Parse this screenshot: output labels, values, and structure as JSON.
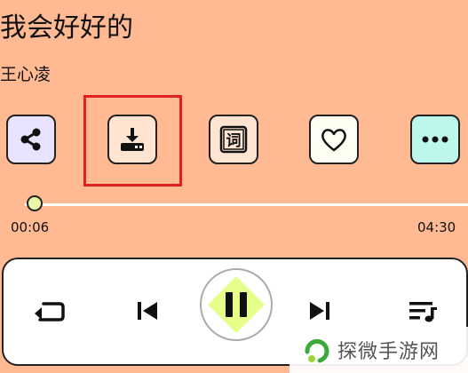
{
  "song": {
    "title": "我会好好的",
    "artist": "王心凌"
  },
  "actions": [
    {
      "name": "share",
      "icon": "share-icon",
      "bg": "#E9E3FF"
    },
    {
      "name": "download",
      "icon": "download-icon",
      "bg": "#FFE4D2"
    },
    {
      "name": "lyrics",
      "icon": "lyrics-icon",
      "label": "词",
      "bg": "#FFE4D2"
    },
    {
      "name": "like",
      "icon": "heart-icon",
      "bg": "#FFFFF3"
    },
    {
      "name": "more",
      "icon": "more-icon",
      "bg": "#BDF6EA"
    }
  ],
  "progress": {
    "current": "00:06",
    "total": "04:30",
    "fraction": 0.022
  },
  "controls": {
    "repeat": "repeat-icon",
    "previous": "previous-icon",
    "play_pause": "pause-icon",
    "next": "next-icon",
    "playlist": "playlist-icon"
  },
  "watermark": {
    "text": "探微手游网"
  },
  "colors": {
    "background": "#FFB993",
    "highlight": "#E0201C",
    "play_accent": "#E6FF8A"
  }
}
